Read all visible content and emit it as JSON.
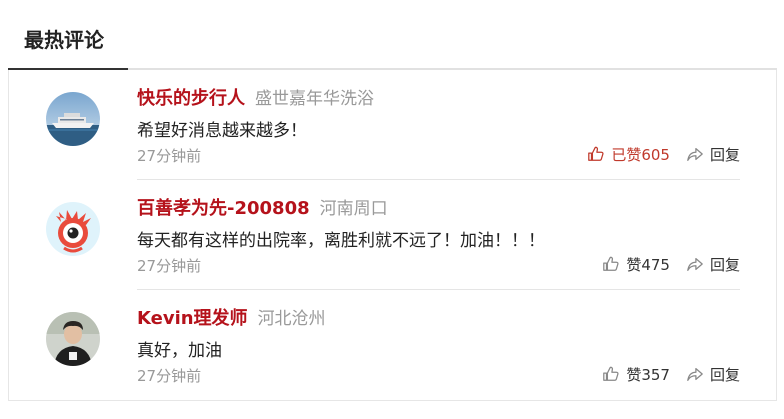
{
  "section": {
    "title": "最热评论"
  },
  "comments": [
    {
      "username": "快乐的步行人",
      "location": "盛世嘉年华洗浴",
      "text": "希望好消息越来越多！",
      "time": "27分钟前",
      "like_label": "已赞605",
      "reply_label": "回复",
      "liked": true,
      "avatar": "cruise-ship-photo"
    },
    {
      "username": "百善孝为先-200808",
      "location": "河南周口",
      "text": "每天都有这样的出院率，离胜利就不远了！加油！！！",
      "time": "27分钟前",
      "like_label": "赞475",
      "reply_label": "回复",
      "liked": false,
      "avatar": "weibo-eye-mascot"
    },
    {
      "username": "Kevin理发师",
      "location": "河北沧州",
      "text": "真好，加油",
      "time": "27分钟前",
      "like_label": "赞357",
      "reply_label": "回复",
      "liked": false,
      "avatar": "person-photo"
    }
  ],
  "colors": {
    "username": "#b5121b",
    "liked": "#c0392b",
    "muted": "#999999"
  }
}
